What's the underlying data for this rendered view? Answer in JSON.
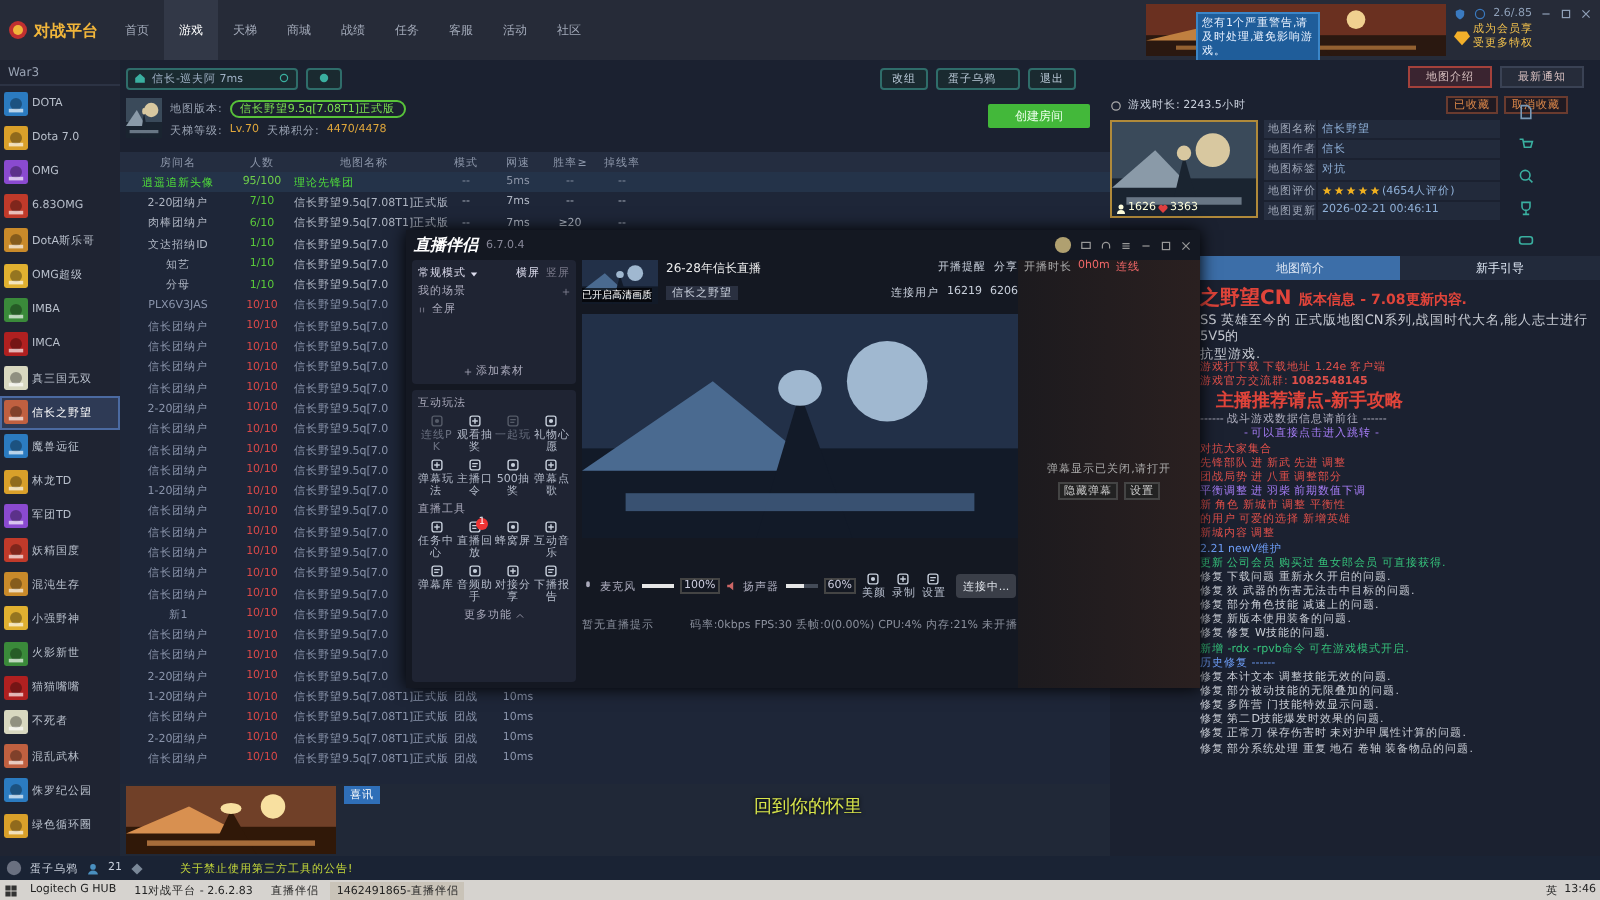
{
  "topbar": {
    "logo": "对战平台",
    "nav": [
      {
        "label": "首页",
        "selected": false
      },
      {
        "label": "游戏",
        "selected": true
      },
      {
        "label": "天梯",
        "selected": false
      },
      {
        "label": "商城",
        "selected": false
      },
      {
        "label": "战绩",
        "selected": false
      },
      {
        "label": "任务",
        "selected": false
      },
      {
        "label": "客服",
        "selected": false
      },
      {
        "label": "活动",
        "selected": false
      },
      {
        "label": "社区",
        "selected": false
      }
    ],
    "counter": "2.6/.85",
    "tooltip": "您有1个严重警告,请及时处理,避免影响游戏。",
    "vip": "成为会员享受更多特权"
  },
  "sidebar": {
    "title": "War3",
    "items": [
      {
        "label": "DOTA",
        "selected": false
      },
      {
        "label": "Dota 7.0",
        "selected": false
      },
      {
        "label": "OMG",
        "selected": false
      },
      {
        "label": "6.83OMG",
        "selected": false
      },
      {
        "label": "DotA斯乐哥",
        "selected": false
      },
      {
        "label": "OMG超级",
        "selected": false
      },
      {
        "label": "IMBA",
        "selected": false
      },
      {
        "label": "IMCA",
        "selected": false
      },
      {
        "label": "真三国无双",
        "selected": false
      },
      {
        "label": "信长之野望",
        "selected": true
      },
      {
        "label": "魔兽远征",
        "selected": false
      },
      {
        "label": "林龙TD",
        "selected": false
      },
      {
        "label": "军团TD",
        "selected": false
      },
      {
        "label": "妖精国度",
        "selected": false
      },
      {
        "label": "混沌生存",
        "selected": false
      },
      {
        "label": "小强野神",
        "selected": false
      },
      {
        "label": "火影新世",
        "selected": false
      },
      {
        "label": "猫猫嘴嘴",
        "selected": false
      },
      {
        "label": "不死者",
        "selected": false
      },
      {
        "label": "混乱武林",
        "selected": false
      },
      {
        "label": "侏罗纪公园",
        "selected": false
      },
      {
        "label": "绿色循环圈",
        "selected": false
      }
    ]
  },
  "toolbar": {
    "search": "信长-巡夫阿 7ms",
    "buttons": [
      "改组",
      "退出"
    ],
    "user_field": "蛋子乌鸦",
    "create": "创建房间"
  },
  "map_info": {
    "version_label": "地图版本:",
    "version": "信长野望9.5q[7.08T1]正式版",
    "level_label": "天梯等级:",
    "level": "Lv.70",
    "score_label": "天梯积分:",
    "score": "4470/4478"
  },
  "table": {
    "columns": [
      "房间名",
      "人数",
      "地图名称",
      "模式",
      "网速",
      "胜率≥",
      "掉线率"
    ],
    "rows": [
      {
        "kind": "featured",
        "cells": [
          "逍遥追新头像",
          "95/100",
          "理论先锋团",
          "--",
          "5ms",
          "--",
          "--"
        ]
      },
      {
        "kind": "open",
        "cells": [
          "2-20团纳户",
          "7/10",
          "信长野望9.5q[7.08T1]正式版",
          "--",
          "7ms",
          "--",
          "--"
        ]
      },
      {
        "kind": "open",
        "cells": [
          "肉棒团纳户",
          "6/10",
          "信长野望9.5q[7.08T1]正式版",
          "--",
          "7ms",
          "≥20",
          "--"
        ]
      },
      {
        "kind": "open",
        "cells": [
          "文达招纳ID",
          "1/10",
          "信长野望9.5q[7.0"
        ]
      },
      {
        "kind": "open",
        "cells": [
          "知艺",
          "1/10",
          "信长野望9.5q[7.0"
        ]
      },
      {
        "kind": "open",
        "cells": [
          "分母",
          "1/10",
          "信长野望9.5q[7.0"
        ]
      },
      {
        "kind": "full",
        "cells": [
          "PLX6V3JAS",
          "10/10",
          "信长野望9.5q[7.0"
        ]
      },
      {
        "kind": "full",
        "cells": [
          "信长团纳户",
          "10/10",
          "信长野望9.5q[7.0"
        ]
      },
      {
        "kind": "full",
        "cells": [
          "信长团纳户",
          "10/10",
          "信长野望9.5q[7.0"
        ]
      },
      {
        "kind": "full",
        "cells": [
          "信长团纳户",
          "10/10",
          "信长野望9.5q[7.0"
        ]
      },
      {
        "kind": "full",
        "cells": [
          "信长团纳户",
          "10/10",
          "信长野望9.5q[7.0"
        ]
      },
      {
        "kind": "full",
        "cells": [
          "2-20团纳户",
          "10/10",
          "信长野望9.5q[7.0"
        ]
      },
      {
        "kind": "full",
        "cells": [
          "信长团纳户",
          "10/10",
          "信长野望9.5q[7.0"
        ]
      },
      {
        "kind": "full",
        "cells": [
          "信长团纳户",
          "10/10",
          "信长野望9.5q[7.0"
        ]
      },
      {
        "kind": "full",
        "cells": [
          "信长团纳户",
          "10/10",
          "信长野望9.5q[7.0"
        ]
      },
      {
        "kind": "full",
        "cells": [
          "1-20团纳户",
          "10/10",
          "信长野望9.5q[7.0"
        ]
      },
      {
        "kind": "full",
        "cells": [
          "信长团纳户",
          "10/10",
          "信长野望9.5q[7.0"
        ]
      },
      {
        "kind": "full",
        "cells": [
          "信长团纳户",
          "10/10",
          "信长野望9.5q[7.0"
        ]
      },
      {
        "kind": "full",
        "cells": [
          "信长团纳户",
          "10/10",
          "信长野望9.5q[7.0"
        ]
      },
      {
        "kind": "full",
        "cells": [
          "信长团纳户",
          "10/10",
          "信长野望9.5q[7.0"
        ]
      },
      {
        "kind": "full",
        "cells": [
          "信长团纳户",
          "10/10",
          "信长野望9.5q[7.0"
        ]
      },
      {
        "kind": "full",
        "cells": [
          "新1",
          "10/10",
          "信长野望9.5q[7.0"
        ]
      },
      {
        "kind": "full",
        "cells": [
          "信长团纳户",
          "10/10",
          "信长野望9.5q[7.0"
        ]
      },
      {
        "kind": "full",
        "cells": [
          "信长团纳户",
          "10/10",
          "信长野望9.5q[7.0"
        ]
      },
      {
        "kind": "full",
        "cells": [
          "2-20团纳户",
          "10/10",
          "信长野望9.5q[7.0"
        ]
      },
      {
        "kind": "full",
        "cells": [
          "1-20团纳户",
          "10/10",
          "信长野望9.5q[7.08T1]正式版",
          "团战",
          "10ms"
        ]
      },
      {
        "kind": "full",
        "cells": [
          "信长团纳户",
          "10/10",
          "信长野望9.5q[7.08T1]正式版",
          "团战",
          "10ms"
        ]
      },
      {
        "kind": "full",
        "cells": [
          "2-20团纳户",
          "10/10",
          "信长野望9.5q[7.08T1]正式版",
          "团战",
          "10ms"
        ]
      },
      {
        "kind": "full",
        "cells": [
          "信长团纳户",
          "10/10",
          "信长野望9.5q[7.08T1]正式版",
          "团战",
          "10ms"
        ]
      }
    ]
  },
  "ad_tag": "喜讯",
  "right": {
    "tabs_top": [
      {
        "label": "地图介绍",
        "selected": true
      },
      {
        "label": "最新通知",
        "selected": false
      }
    ],
    "playtime": "游戏时长: 2243.5小时",
    "actions": [
      "已收藏",
      "取消收藏"
    ],
    "likes": "1626",
    "hearts": "3363",
    "info": [
      {
        "label": "地图名称",
        "value": "信长野望",
        "kind": "text"
      },
      {
        "label": "地图作者",
        "value": "信长",
        "kind": "text"
      },
      {
        "label": "地图标签",
        "value": "对抗",
        "kind": "text"
      },
      {
        "label": "地图评价",
        "value": "(4654人评价)",
        "kind": "stars",
        "stars": 5
      },
      {
        "label": "地图更新",
        "value": "2026-02-21 00:46:11",
        "kind": "text"
      }
    ],
    "tabs": [
      {
        "label": "地图简介",
        "selected": true
      },
      {
        "label": "新手引导",
        "selected": false
      }
    ],
    "desc_title": "之野望CN",
    "desc_subtitle": "版本信息 - 7.08更新内容.",
    "lines": [
      {
        "kind": "body",
        "text": "SS 英雄至今的 正式版地图CN系列,战国时代大名,能人志士进行5V5的"
      },
      {
        "kind": "body",
        "text": "抗型游戏."
      },
      {
        "kind": "red",
        "text": "游戏打下载 下载地址 1.24e 客户端"
      },
      {
        "kind": "red",
        "text": "游戏官方交流群: **1082548145**"
      },
      {
        "kind": "heading",
        "text": "主播推荐请点-新手攻略"
      },
      {
        "kind": "divider",
        "text": "------ 战斗游戏数据信息请前往 ------"
      },
      {
        "kind": "purple",
        "text": "- 可以直接点击进入跳转 -"
      },
      {
        "kind": "red",
        "text": "对抗大家集合"
      },
      {
        "kind": "red",
        "text": "先锋部队 进 新武 先进 调整"
      },
      {
        "kind": "red",
        "text": "团战局势 进 八重 调整部分"
      },
      {
        "kind": "purple",
        "text": "平衡调整 进 羽柴 前期数值下调"
      },
      {
        "kind": "red",
        "text": "新 角色 新城市 调整 平衡性"
      },
      {
        "kind": "red",
        "text": "的用户 可爱的选择 新增英雄"
      },
      {
        "kind": "red",
        "text": "新城内容 调整"
      },
      {
        "kind": "blue",
        "text": "2.21 newV维护"
      },
      {
        "kind": "green",
        "text": "更新 公司会员 购买过 鱼女郎会员 可直接获得."
      },
      {
        "kind": "body",
        "text": "修复 下载问题 重新永久开启的问题."
      },
      {
        "kind": "body",
        "text": "修复 狄 武器的伤害无法击中目标的问题."
      },
      {
        "kind": "body",
        "text": "修复 部分角色技能 减速上的问题."
      },
      {
        "kind": "body",
        "text": "修复 新版本使用装备的问题."
      },
      {
        "kind": "body",
        "text": "修复 修复 W技能的问题."
      },
      {
        "kind": "green",
        "text": "新增 -rdx -rpvb命令 可在游戏模式开启."
      },
      {
        "kind": "blue",
        "text": "历史修复 ------"
      },
      {
        "kind": "body",
        "text": "修复 本计文本 调整技能无效的问题."
      },
      {
        "kind": "body",
        "text": "修复 部分被动技能的无限叠加的问题."
      },
      {
        "kind": "body",
        "text": "修复 多阵营 门技能特效显示问题."
      },
      {
        "kind": "body",
        "text": "修复 第二D技能爆发时效果的问题."
      },
      {
        "kind": "body",
        "text": "修复 正常刀 保存伤害时 未对护甲属性计算的问题."
      },
      {
        "kind": "body",
        "text": "修复 部分系统处理 重复 地石 卷轴 装备物品的问题."
      }
    ]
  },
  "status": {
    "user": "蛋子乌鸦",
    "friends": "21",
    "notice": "关于禁止使用第三方工具的公告!"
  },
  "subtitle": "回到你的怀里",
  "stream": {
    "logo": "直播伴侣",
    "version": "6.7.0.4",
    "mode": "常规模式",
    "orient": [
      {
        "label": "横屏",
        "selected": true
      },
      {
        "label": "竖屏",
        "selected": false
      }
    ],
    "scene_label": "我的场景",
    "scene": "全屏",
    "add": "添加素材",
    "play_title": "互动玩法",
    "play": [
      {
        "label": "连线PK",
        "disabled": true
      },
      {
        "label": "观看抽奖",
        "disabled": false
      },
      {
        "label": "一起玩",
        "disabled": true
      },
      {
        "label": "礼物心愿",
        "disabled": false
      },
      {
        "label": "弹幕玩法",
        "disabled": false
      },
      {
        "label": "主播口令",
        "disabled": false
      },
      {
        "label": "500抽奖",
        "disabled": false
      },
      {
        "label": "弹幕点歌",
        "disabled": false
      }
    ],
    "tools_title": "直播工具",
    "tools": [
      {
        "label": "任务中心"
      },
      {
        "label": "直播回放",
        "badge": "1"
      },
      {
        "label": "蜂窝屏"
      },
      {
        "label": "互动音乐"
      },
      {
        "label": "弹幕库"
      },
      {
        "label": "音频助手"
      },
      {
        "label": "对接分享"
      },
      {
        "label": "下播报告"
      }
    ],
    "more": "更多功能",
    "title": "26-28年信长直播",
    "tag": "信长之野望",
    "remind": "开播提醒",
    "share": "分享",
    "thumb_label": "已开启高清画质",
    "fans_label": "连接用户",
    "likes": "16219",
    "comments": "6206",
    "mic": {
      "label": "麦克风",
      "reading": "100%",
      "level": 1
    },
    "speaker": {
      "label": "扬声器",
      "reading": "60%",
      "level": 0.6
    },
    "controls": [
      "美颜",
      "录制",
      "设置"
    ],
    "connect": "连接中...",
    "footer_left": "暂无直播提示",
    "stats": [
      "码率:0kbps",
      "FPS:30",
      "丢帧:0(0.00%)",
      "CPU:4%",
      "内存:21%",
      "未开播"
    ],
    "chat": {
      "duration_label": "开播时长",
      "duration": "0h0m",
      "pk": "连线",
      "empty": "弹幕显示已关闭,请打开",
      "buttons": [
        "隐藏弹幕",
        "设置"
      ]
    }
  },
  "taskbar": {
    "items": [
      "Logitech G HUB",
      "11对战平台 - 2.6.2.83",
      "直播伴侣",
      "1462491865-直播伴侣"
    ],
    "lang": "英",
    "time": "13:46"
  }
}
